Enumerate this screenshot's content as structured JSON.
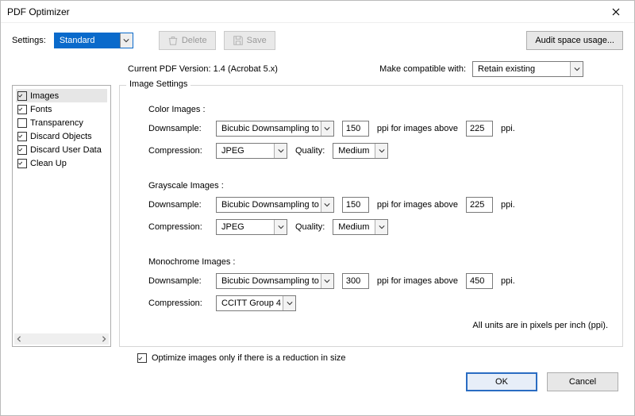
{
  "window": {
    "title": "PDF Optimizer"
  },
  "toolbar": {
    "settings_label": "Settings:",
    "settings_value": "Standard",
    "delete_label": "Delete",
    "save_label": "Save",
    "audit_label": "Audit space usage..."
  },
  "info": {
    "current_label": "Current PDF Version: 1.4 (Acrobat 5.x)",
    "compat_label": "Make compatible with:",
    "compat_value": "Retain existing"
  },
  "sidebar": {
    "items": [
      {
        "label": "Images",
        "checked": true,
        "selected": true
      },
      {
        "label": "Fonts",
        "checked": true
      },
      {
        "label": "Transparency",
        "checked": false
      },
      {
        "label": "Discard Objects",
        "checked": true
      },
      {
        "label": "Discard User Data",
        "checked": true
      },
      {
        "label": "Clean Up",
        "checked": true
      }
    ]
  },
  "panel": {
    "legend": "Image Settings",
    "phrases": {
      "downsample": "Downsample:",
      "compression": "Compression:",
      "quality": "Quality:",
      "ppi_for_above": "ppi for images above",
      "ppi_suffix": "ppi."
    },
    "color": {
      "heading": "Color Images :",
      "downsample_method": "Bicubic Downsampling to",
      "ppi": "150",
      "above": "225",
      "compression": "JPEG",
      "quality": "Medium"
    },
    "gray": {
      "heading": "Grayscale Images :",
      "downsample_method": "Bicubic Downsampling to",
      "ppi": "150",
      "above": "225",
      "compression": "JPEG",
      "quality": "Medium"
    },
    "mono": {
      "heading": "Monochrome Images :",
      "downsample_method": "Bicubic Downsampling to",
      "ppi": "300",
      "above": "450",
      "compression": "CCITT Group 4"
    },
    "units_note": "All units are in pixels per inch (ppi)."
  },
  "footer": {
    "optimize_only_label": "Optimize images only if there is a reduction in size",
    "optimize_only_checked": true,
    "ok": "OK",
    "cancel": "Cancel"
  }
}
